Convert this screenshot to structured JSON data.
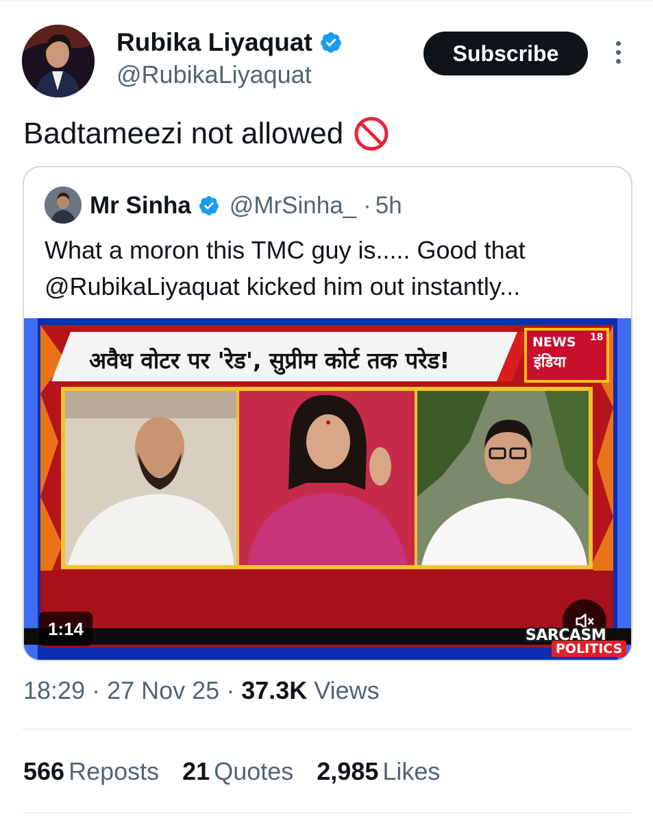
{
  "author": {
    "display_name": "Rubika Liyaquat",
    "handle": "@RubikaLiyaquat",
    "verified_icon": "verified-badge-icon"
  },
  "actions": {
    "subscribe_label": "Subscribe",
    "more_icon": "more-vertical-icon"
  },
  "tweet": {
    "text": "Badtameezi not allowed",
    "emoji_icon": "no-entry-sign-icon"
  },
  "quote": {
    "display_name": "Mr Sinha",
    "handle": "@MrSinha_",
    "separator": "·",
    "time": "5h",
    "text": "What a moron this TMC guy is..... Good that @RubikaLiyaquat kicked him out instantly...",
    "video": {
      "banner_text": "अवैध वोटर पर 'रेड', सुप्रीम कोर्ट तक परेड!",
      "channel_word": "NEWS",
      "channel_number": "18",
      "channel_sub": "इंडिया",
      "duration": "1:14",
      "watermark_line1": "SARCASM",
      "watermark_line2": "POLITICS",
      "mute_icon": "speaker-muted-icon"
    }
  },
  "meta": {
    "time": "18:29",
    "sep1": " · ",
    "date": "27 Nov 25",
    "sep2": " · ",
    "views_count": "37.3K",
    "views_label": " Views"
  },
  "stats": {
    "reposts_count": "566",
    "reposts_label": "Reposts",
    "quotes_count": "21",
    "quotes_label": "Quotes",
    "likes_count": "2,985",
    "likes_label": "Likes"
  },
  "colors": {
    "accent_blue": "#1d9bf0",
    "text_primary": "#0f1419",
    "text_secondary": "#536471",
    "divider": "#eff3f4"
  }
}
